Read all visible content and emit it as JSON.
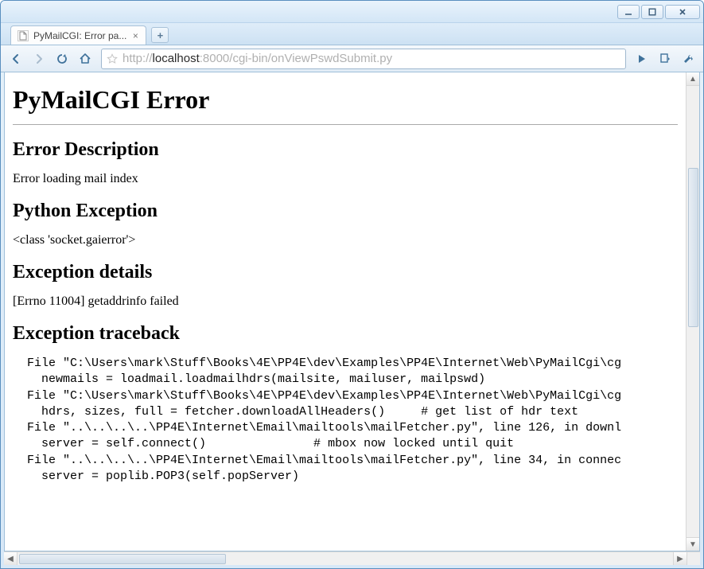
{
  "window": {
    "tab_title": "PyMailCGI: Error pa..."
  },
  "address": {
    "protocol": "http://",
    "host": "localhost",
    "port": ":8000",
    "path": "/cgi-bin/onViewPswdSubmit.py"
  },
  "page": {
    "h1": "PyMailCGI Error",
    "sections": {
      "error_description": {
        "heading": "Error Description",
        "text": "Error loading mail index"
      },
      "python_exception": {
        "heading": "Python Exception",
        "text": "<class 'socket.gaierror'>"
      },
      "exception_details": {
        "heading": "Exception details",
        "text": "[Errno 11004] getaddrinfo failed"
      },
      "exception_traceback": {
        "heading": "Exception traceback"
      }
    },
    "traceback": "  File \"C:\\Users\\mark\\Stuff\\Books\\4E\\PP4E\\dev\\Examples\\PP4E\\Internet\\Web\\PyMailCgi\\cg\n    newmails = loadmail.loadmailhdrs(mailsite, mailuser, mailpswd)\n  File \"C:\\Users\\mark\\Stuff\\Books\\4E\\PP4E\\dev\\Examples\\PP4E\\Internet\\Web\\PyMailCgi\\cg\n    hdrs, sizes, full = fetcher.downloadAllHeaders()     # get list of hdr text\n  File \"..\\..\\..\\..\\PP4E\\Internet\\Email\\mailtools\\mailFetcher.py\", line 126, in downl\n    server = self.connect()               # mbox now locked until quit\n  File \"..\\..\\..\\..\\PP4E\\Internet\\Email\\mailtools\\mailFetcher.py\", line 34, in connec\n    server = poplib.POP3(self.popServer)"
  }
}
